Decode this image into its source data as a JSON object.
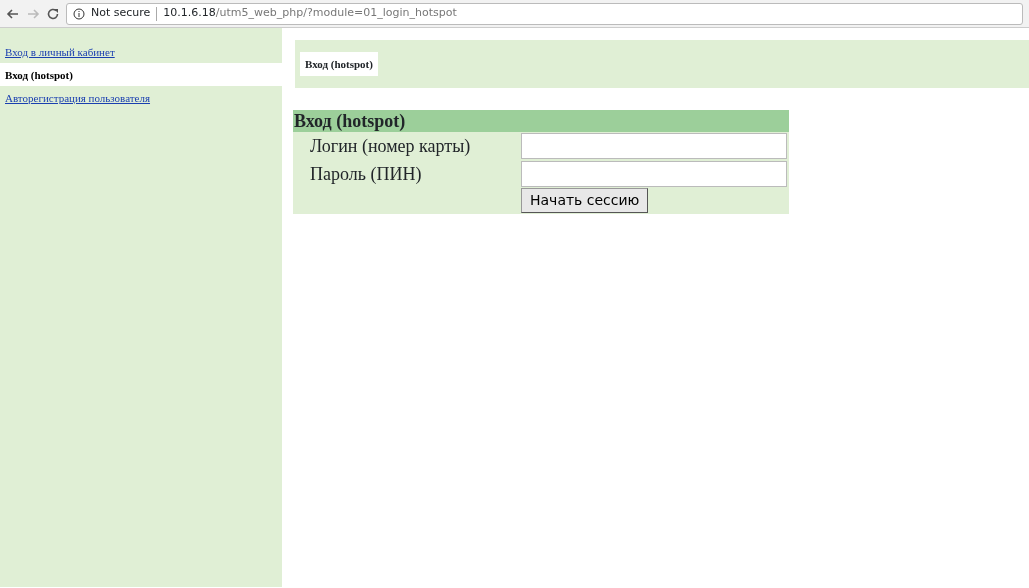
{
  "browser": {
    "security": "Not secure",
    "url_host": "10.1.6.18",
    "url_path": "/utm5_web_php/?module=01_login_hotspot"
  },
  "sidebar": {
    "items": [
      {
        "label": "Вход в личный кабинет",
        "selected": false
      },
      {
        "label": "Вход (hotspot)",
        "selected": true
      },
      {
        "label": "Авторегистрация пользователя",
        "selected": false
      }
    ]
  },
  "page_tabs": [
    {
      "label": "Вход (hotspot)",
      "selected": true
    }
  ],
  "form": {
    "title": "Вход (hotspot)",
    "fields": [
      {
        "label": "Логин (номер карты)"
      },
      {
        "label": "Пароль (ПИН)"
      }
    ],
    "submit": "Начать сессию"
  }
}
